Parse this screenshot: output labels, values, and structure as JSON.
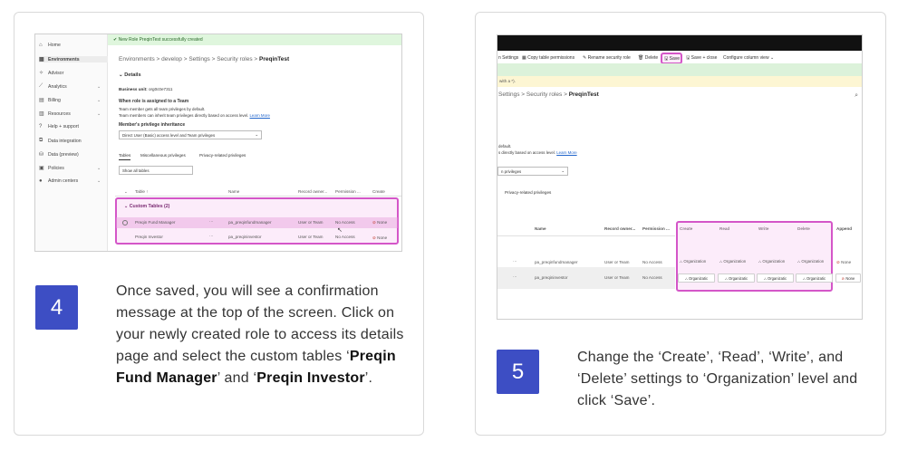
{
  "step4": {
    "number": "4",
    "desc_pre": "Once saved, you will see a confirmation message at the top of the screen. Click on your newly created role to access its details page and select the custom tables ‘",
    "desc_b1": "Preqin Fund Manager",
    "desc_mid": "’ and ‘",
    "desc_b2": "Preqin Investor",
    "desc_post": "’.",
    "screenshot": {
      "nav": [
        "Home",
        "Environments",
        "Advisor",
        "Analytics",
        "Billing",
        "Resources",
        "Help + support",
        "Data integration",
        "Data (preview)",
        "Policies",
        "Admin centers"
      ],
      "banner": "New Role PreqinTest successfully created",
      "breadcrumb": "Environments  >  develop  >  Settings  >  Security roles  >",
      "breadcrumb_current": "PreqinTest",
      "details": "Details",
      "bu_label": "Business unit:",
      "bu_value": "org0c0e7311",
      "assign_title": "When role is assigned to a Team",
      "assign_l1": "Team member gets all team privileges by default.",
      "assign_l2": "Team members can inherit team privileges directly based on access level.",
      "learn_more": "Learn More",
      "inherit_title": "Member's privilege inheritance",
      "inherit_value": "Direct User (Basic) access level and Team privileges",
      "tabs": [
        "Tables",
        "Miscellaneous privileges",
        "Privacy-related privileges"
      ],
      "filter": "Show all tables",
      "headers": [
        "Table ↑",
        "Name",
        "Record owner...",
        "Permission ...",
        "Create"
      ],
      "group": "Custom Tables (2)",
      "rows": [
        {
          "table": "Preqin Fund Manager",
          "name": "pa_preqinfundmanager",
          "owner": "User or Team",
          "perm": "No Access",
          "create": "None"
        },
        {
          "table": "Preqin Investor",
          "name": "pa_preqininvestor",
          "owner": "User or Team",
          "perm": "No Access",
          "create": "None"
        }
      ]
    }
  },
  "step5": {
    "number": "5",
    "desc": "Change the ‘Create’, ‘Read’, ‘Write’, and ‘Delete’ settings to ‘Organization’ level and click ‘Save’.",
    "screenshot": {
      "toolbar": [
        "n Settings",
        "Copy table permissions",
        "Rename security role",
        "Delete",
        "Save",
        "Save + close",
        "Configure column view"
      ],
      "yellow": "with a *).",
      "breadcrumb": "Settings  >  Security roles  >",
      "breadcrumb_current": "PreqinTest",
      "line1": "default.",
      "line2": "s directly based on access level.",
      "learn_more": "Learn More",
      "dropdown": "n privileges",
      "tab": "Privacy-related privileges",
      "headers": [
        "Name",
        "Record owner...",
        "Permission ...",
        "Create",
        "Read",
        "Write",
        "Delete",
        "Append"
      ],
      "rows": [
        {
          "name": "pa_preqinfundmanager",
          "owner": "User or Team",
          "perm": "No Access",
          "org": "Organization",
          "org_cut": "Organizatic",
          "append": "None"
        },
        {
          "name": "pa_preqininvestor",
          "owner": "User or Team",
          "perm": "No Access",
          "org": "Organization",
          "org_cut": "Organizatic",
          "append": "None"
        }
      ]
    }
  }
}
